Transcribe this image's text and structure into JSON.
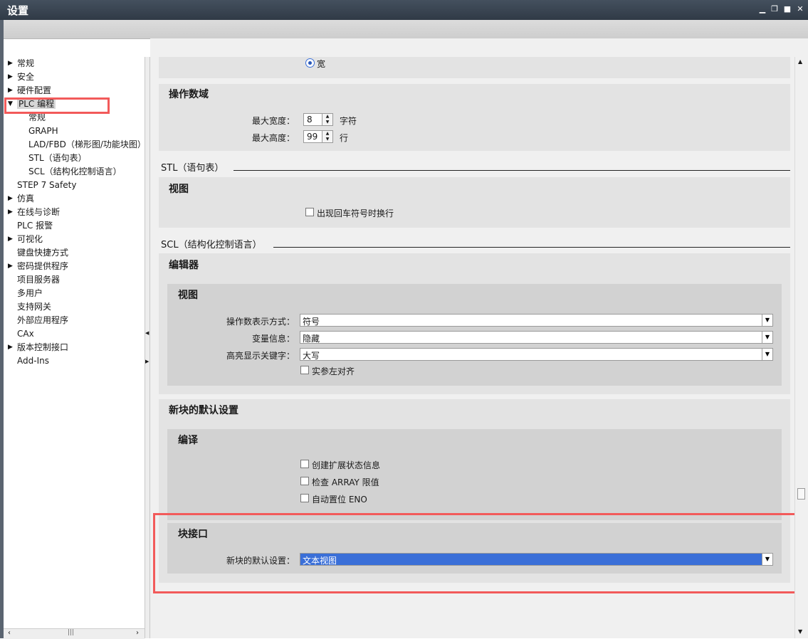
{
  "window": {
    "title": "设置"
  },
  "nav": {
    "items": [
      {
        "label": "常规",
        "arrow": "▶",
        "level": 0
      },
      {
        "label": "安全",
        "arrow": "▶",
        "level": 0
      },
      {
        "label": "硬件配置",
        "arrow": "▶",
        "level": 0
      },
      {
        "label": "PLC 编程",
        "arrow": "▼",
        "level": 0,
        "selected": true
      },
      {
        "label": "常规",
        "arrow": "",
        "level": 1
      },
      {
        "label": "GRAPH",
        "arrow": "",
        "level": 1
      },
      {
        "label": "LAD/FBD（梯形图/功能块图）",
        "arrow": "",
        "level": 1
      },
      {
        "label": "STL（语句表）",
        "arrow": "",
        "level": 1
      },
      {
        "label": "SCL（结构化控制语言）",
        "arrow": "",
        "level": 1
      },
      {
        "label": "STEP 7 Safety",
        "arrow": "",
        "level": 0
      },
      {
        "label": "仿真",
        "arrow": "▶",
        "level": 0
      },
      {
        "label": "在线与诊断",
        "arrow": "▶",
        "level": 0
      },
      {
        "label": "PLC 报警",
        "arrow": "",
        "level": 0
      },
      {
        "label": "可视化",
        "arrow": "▶",
        "level": 0
      },
      {
        "label": "键盘快捷方式",
        "arrow": "",
        "level": 0
      },
      {
        "label": "密码提供程序",
        "arrow": "▶",
        "level": 0
      },
      {
        "label": "项目服务器",
        "arrow": "",
        "level": 0
      },
      {
        "label": "多用户",
        "arrow": "",
        "level": 0
      },
      {
        "label": "支持网关",
        "arrow": "",
        "level": 0
      },
      {
        "label": "外部应用程序",
        "arrow": "",
        "level": 0
      },
      {
        "label": "CAx",
        "arrow": "",
        "level": 0
      },
      {
        "label": "版本控制接口",
        "arrow": "▶",
        "level": 0
      },
      {
        "label": "Add-Ins",
        "arrow": "",
        "level": 0
      }
    ]
  },
  "content": {
    "radio_wide": "宽",
    "operand_field": {
      "heading": "操作数域",
      "max_width_label": "最大宽度：",
      "max_width_value": "8",
      "max_width_unit": "字符",
      "max_height_label": "最大高度：",
      "max_height_value": "99",
      "max_height_unit": "行"
    },
    "stl": {
      "section": "STL（语句表）",
      "view_heading": "视图",
      "wrap_label": "出现回车符号时换行"
    },
    "scl": {
      "section": "SCL（结构化控制语言）",
      "editor_heading": "编辑器",
      "view_heading": "视图",
      "operand_display_label": "操作数表示方式：",
      "operand_display_value": "符号",
      "variable_info_label": "变量信息：",
      "variable_info_value": "隐藏",
      "highlight_kw_label": "高亮显示关键字：",
      "highlight_kw_value": "大写",
      "align_label": "实参左对齐"
    },
    "new_block": {
      "heading": "新块的默认设置",
      "compile_heading": "编译",
      "ext_status_label": "创建扩展状态信息",
      "array_limits_label": "检查 ARRAY 限值",
      "auto_eno_label": "自动置位 ENO",
      "interface_heading": "块接口",
      "default_label": "新块的默认设置：",
      "default_value": "文本视图"
    }
  },
  "colors": {
    "highlight_box": "#f25a5a",
    "selection": "#3a6fd8"
  }
}
